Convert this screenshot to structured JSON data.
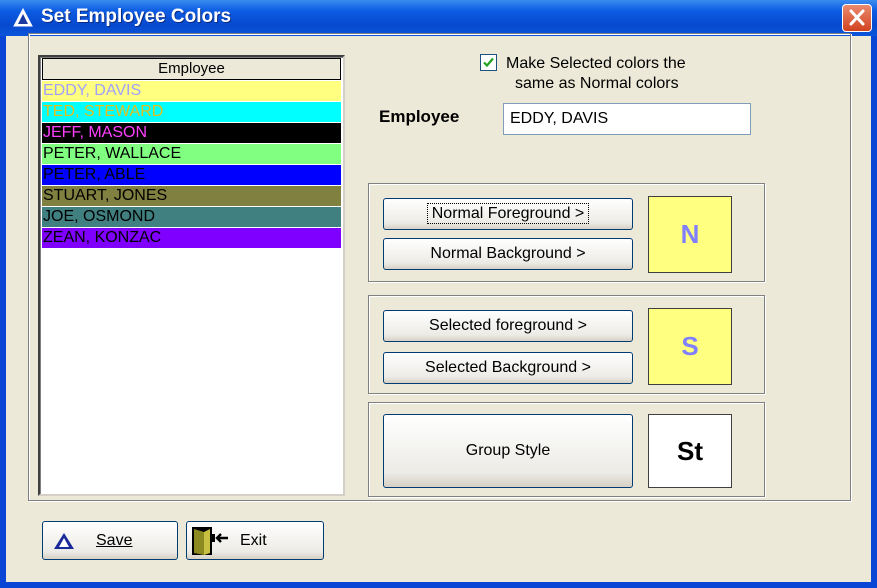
{
  "window": {
    "title": "Set Employee Colors"
  },
  "list": {
    "header": "Employee",
    "items": [
      {
        "name": "EDDY, DAVIS",
        "fg": "#a0a0ff",
        "bg": "#ffff80"
      },
      {
        "name": "TED, STEWARD",
        "fg": "#e0c020",
        "bg": "#00ffff"
      },
      {
        "name": "JEFF, MASON",
        "fg": "#ff40ff",
        "bg": "#000000"
      },
      {
        "name": "PETER, WALLACE",
        "fg": "#000000",
        "bg": "#80ff80"
      },
      {
        "name": "PETER, ABLE",
        "fg": "#000000",
        "bg": "#0000ff"
      },
      {
        "name": "STUART, JONES",
        "fg": "#000000",
        "bg": "#808040"
      },
      {
        "name": "JOE, OSMOND",
        "fg": "#000000",
        "bg": "#408080"
      },
      {
        "name": "ZEAN, KONZAC",
        "fg": "#000000",
        "bg": "#8000ff"
      }
    ]
  },
  "options": {
    "same_colors_checked": true,
    "same_colors_label_line1": "Make Selected colors the",
    "same_colors_label_line2": "same as Normal colors"
  },
  "employee": {
    "label": "Employee",
    "value": "EDDY, DAVIS"
  },
  "normal": {
    "foreground_button": "Normal Foreground >",
    "background_button": "Normal Background >",
    "swatch_text": "N",
    "swatch_fg": "#8080ff",
    "swatch_bg": "#ffff80"
  },
  "selected": {
    "foreground_button": "Selected foreground >",
    "background_button": "Selected Background >",
    "swatch_text": "S",
    "swatch_fg": "#8080ff",
    "swatch_bg": "#ffff80"
  },
  "group_style": {
    "button": "Group Style",
    "swatch_text": "St"
  },
  "footer": {
    "save_label": "Save",
    "exit_label": "Exit"
  }
}
